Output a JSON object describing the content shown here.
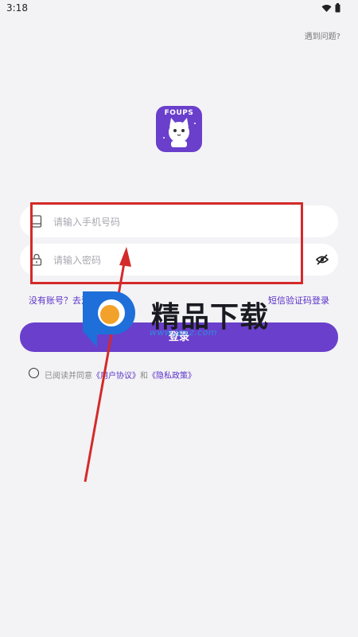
{
  "status_bar": {
    "time": "3:18"
  },
  "header": {
    "help_link": "遇到问题?"
  },
  "logo": {
    "text": "FOUPS"
  },
  "form": {
    "phone_placeholder": "请输入手机号码",
    "password_placeholder": "请输入密码",
    "register_link": "没有账号？去注册",
    "sms_login_link": "短信验证码登录",
    "login_button": "登录"
  },
  "agreement": {
    "prefix": "已阅读并同意",
    "user_agreement": "《用户协议》",
    "and": "和",
    "privacy_policy": "《隐私政策》"
  },
  "watermark": {
    "title": "精品下载",
    "url": "www.jpxz.com"
  },
  "colors": {
    "accent": "#6a3fcb",
    "annotation": "#d42a2a",
    "background": "#f3f3f5"
  },
  "icons": [
    "wifi-icon",
    "battery-icon",
    "phone-icon",
    "lock-icon",
    "eye-off-icon"
  ]
}
